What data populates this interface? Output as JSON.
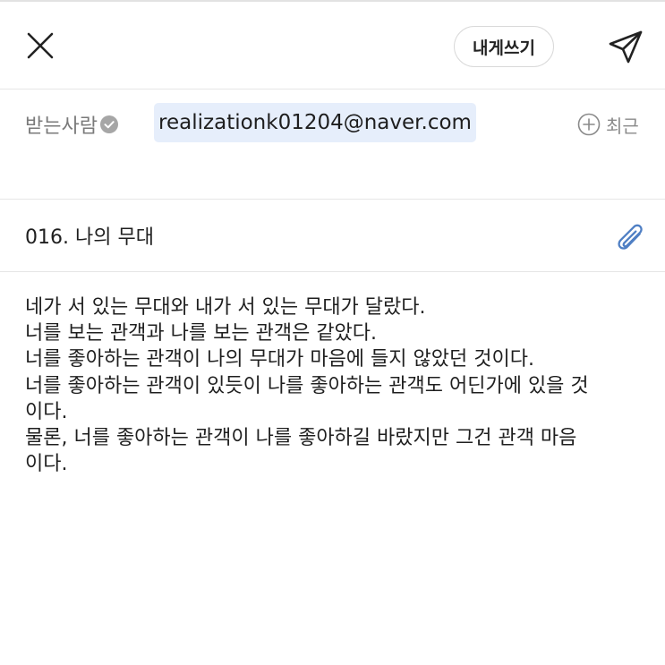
{
  "header": {
    "self_label": "내게쓰기",
    "icons": {
      "close": "close-icon",
      "send": "send-paper-plane-icon"
    }
  },
  "recipient": {
    "label": "받는사람",
    "email": "realizationk01204@naver.com",
    "recent_label": "최근",
    "icons": {
      "verify": "check-circle-icon",
      "add": "plus-circle-icon"
    }
  },
  "subject": {
    "text": "016. 나의 무대",
    "icons": {
      "attach": "paperclip-icon"
    }
  },
  "body": {
    "lines": [
      "네가 서 있는 무대와 내가 서 있는 무대가 달랐다.",
      "너를 보는 관객과 나를 보는 관객은 같았다.",
      "너를 좋아하는 관객이 나의 무대가 마음에 들지 않았던 것이다.",
      "너를 좋아하는 관객이 있듯이 나를 좋아하는 관객도 어딘가에 있을 것",
      "이다.",
      "물론, 너를 좋아하는 관객이 나를 좋아하길 바랐지만 그건 관객 마음",
      "이다."
    ]
  },
  "colors": {
    "accent_blue": "#4f7fc4",
    "chip_bg": "#e6eefb",
    "muted_text": "#7a7a7a",
    "divider": "#e6e6e6"
  }
}
